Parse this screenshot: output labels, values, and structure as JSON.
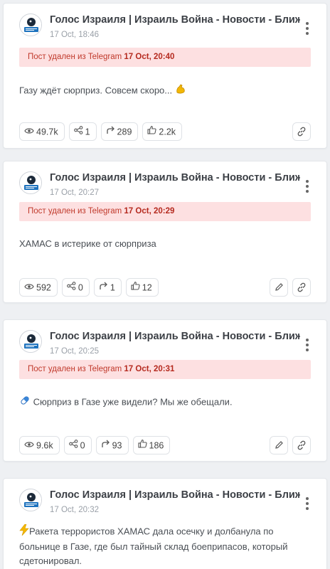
{
  "deleted_prefix": "Пост удален из Telegram",
  "posts": [
    {
      "channel": "Голос Израиля | Израиль Война - Новости - Ближний Восток",
      "date": "17 Oct, 18:46",
      "deleted_at": "17 Oct, 20:40",
      "text": "Газу ждёт сюрприз. Совсем скоро...",
      "emoji": "flexed-biceps-icon",
      "views": "49.7k",
      "shares": "1",
      "forwards": "289",
      "likes": "2.2k",
      "has_edit": false
    },
    {
      "channel": "Голос Израиля | Израиль Война - Новости - Ближний Восток",
      "date": "17 Oct, 20:27",
      "deleted_at": "17 Oct, 20:29",
      "text": "ХАМАС в истерике от сюрприза",
      "views": "592",
      "shares": "0",
      "forwards": "1",
      "likes": "12",
      "has_edit": true
    },
    {
      "channel": "Голос Израиля | Израиль Война - Новости - Ближний Восток",
      "date": "17 Oct, 20:25",
      "deleted_at": "17 Oct, 20:31",
      "text": "Сюрприз в Газе уже видели? Мы же обещали.",
      "emoji": "pill-icon",
      "views": "9.6k",
      "shares": "0",
      "forwards": "93",
      "likes": "186",
      "has_edit": true
    },
    {
      "channel": "Голос Израиля | Израиль Война - Новости - Ближний Восток",
      "date": "17 Oct, 20:32",
      "text_lines": [
        "Ракета террористов ХАМАС дала осечку и долбанула по",
        "больнице в Газе, где был тайный склад боеприпасов, который",
        "сдетонировал."
      ],
      "emoji": "lightning-icon"
    }
  ],
  "colors": {
    "background": "#eef0f3",
    "card": "#ffffff",
    "deleted_banner_bg": "#fde0e1",
    "deleted_banner_text": "#c0392b"
  }
}
